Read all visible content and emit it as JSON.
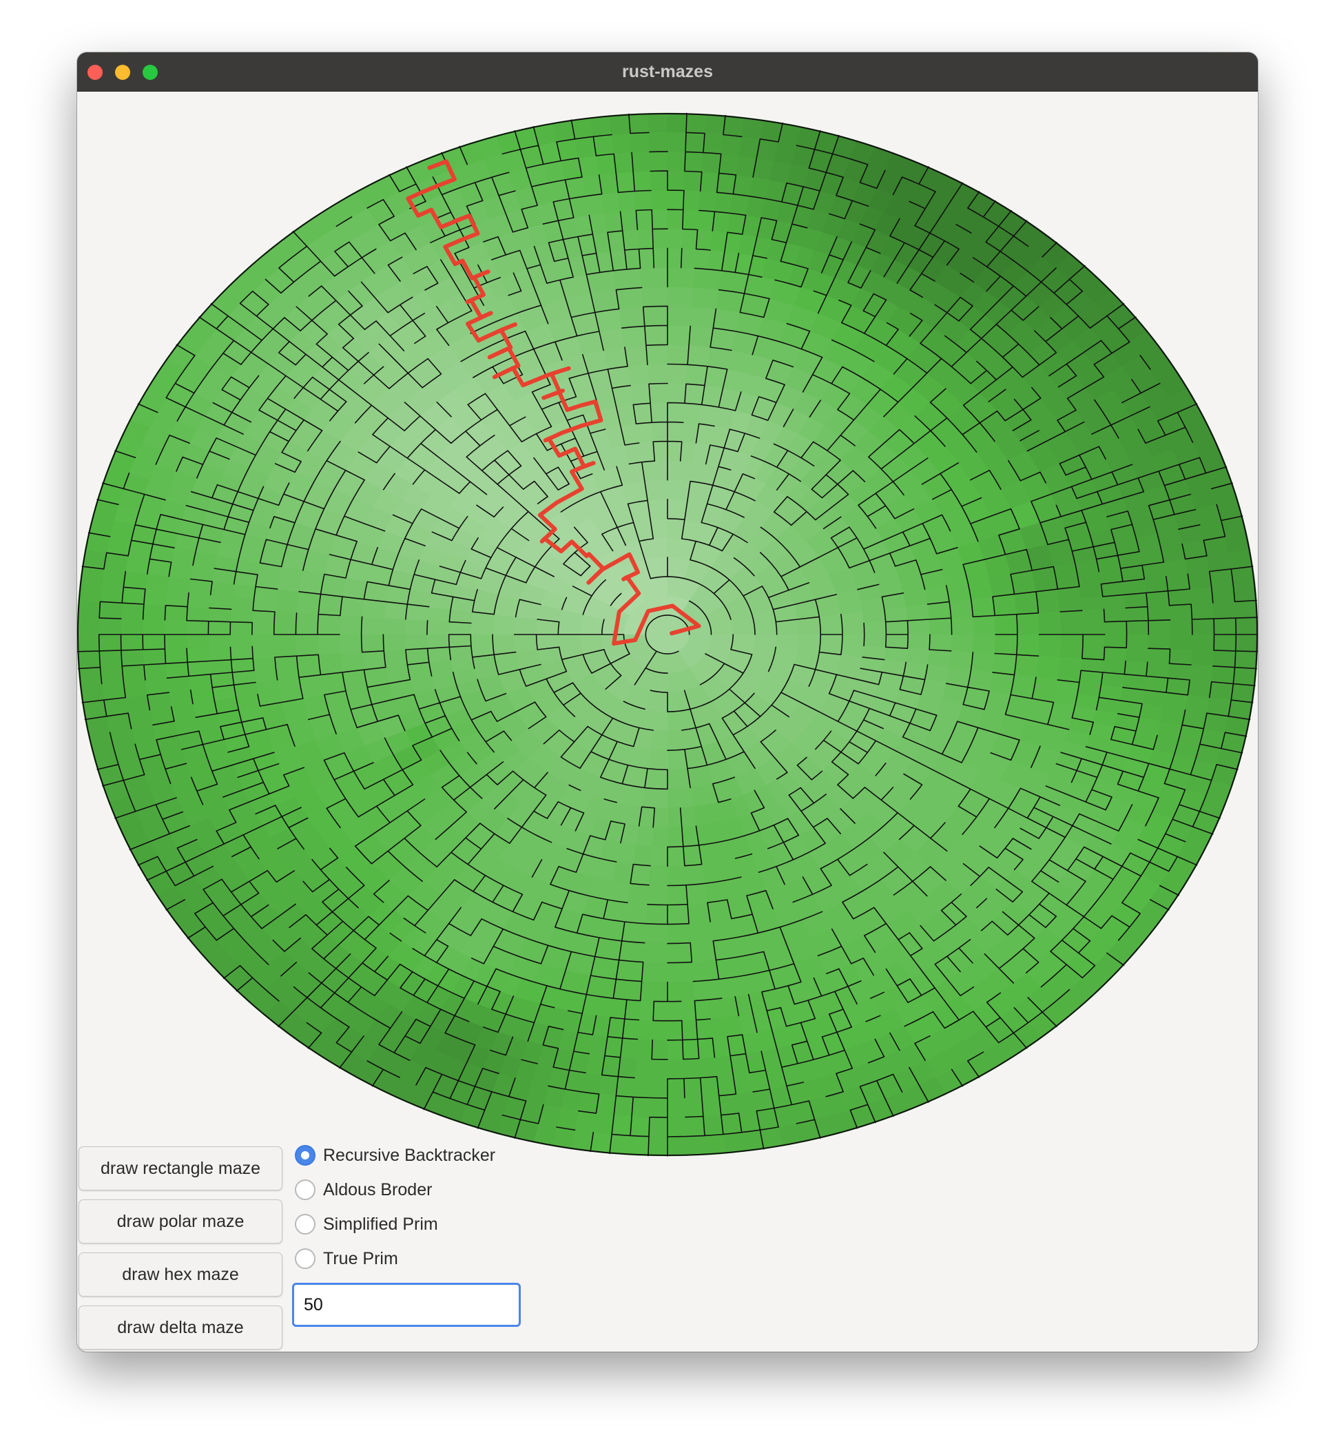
{
  "window": {
    "title": "rust-mazes"
  },
  "maze": {
    "type": "polar",
    "rings": 27,
    "cells_per_ring": [
      1,
      6,
      12,
      24,
      24,
      48,
      48,
      48,
      48,
      96,
      96,
      96,
      96,
      96,
      96,
      96,
      96,
      96,
      96,
      192,
      192,
      192,
      192,
      192,
      192,
      192,
      192
    ],
    "colors": {
      "solution_path": "#e8412f",
      "wall": "#101010"
    }
  },
  "buttons": [
    {
      "label": "draw rectangle maze"
    },
    {
      "label": "draw polar maze"
    },
    {
      "label": "draw hex maze"
    },
    {
      "label": "draw delta maze"
    }
  ],
  "algorithms": [
    {
      "label": "Recursive Backtracker",
      "selected": true
    },
    {
      "label": "Aldous Broder",
      "selected": false
    },
    {
      "label": "Simplified Prim",
      "selected": false
    },
    {
      "label": "True Prim",
      "selected": false
    }
  ],
  "size_input": {
    "value": "50"
  }
}
